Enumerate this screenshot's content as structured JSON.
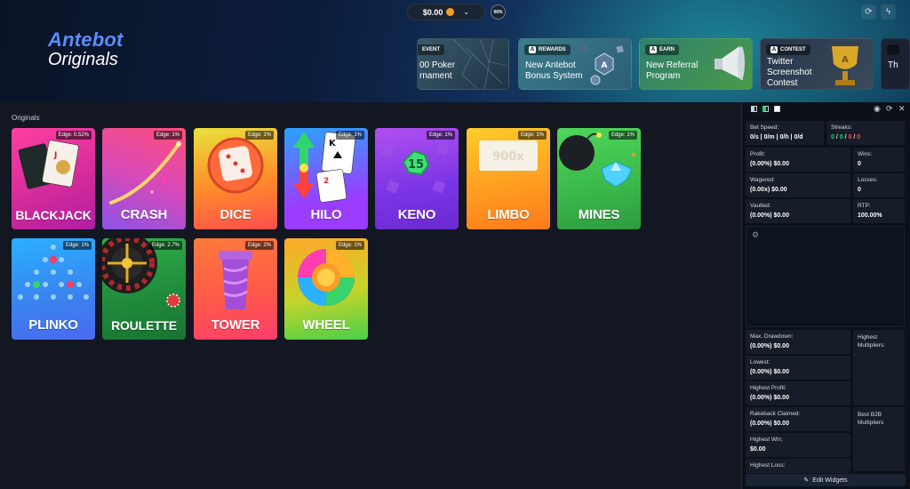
{
  "header": {
    "brand": "Antebot",
    "subtitle": "Originals",
    "balance": "$0.00",
    "percent": "06%"
  },
  "promos": [
    {
      "tag": "EVENT",
      "title": "00 Poker\nrnament"
    },
    {
      "tag": "REWARDS",
      "title": "New Antebot\nBonus System"
    },
    {
      "tag": "EARN",
      "title": "New Referral\nProgram"
    },
    {
      "tag": "CONTEST",
      "title": "Twitter\nScreenshot\nContest"
    },
    {
      "tag": "",
      "title": "Th"
    }
  ],
  "section_label": "Originals",
  "games": [
    {
      "name": "BLACKJACK",
      "edge": "Edge: 0.52%"
    },
    {
      "name": "CRASH",
      "edge": "Edge: 1%"
    },
    {
      "name": "DICE",
      "edge": "Edge: 1%"
    },
    {
      "name": "HILO",
      "edge": "Edge: 1%"
    },
    {
      "name": "KENO",
      "edge": "Edge: 1%"
    },
    {
      "name": "LIMBO",
      "edge": "Edge: 1%"
    },
    {
      "name": "MINES",
      "edge": "Edge: 1%"
    },
    {
      "name": "PLINKO",
      "edge": "Edge: 1%"
    },
    {
      "name": "ROULETTE",
      "edge": "Edge: 2.7%"
    },
    {
      "name": "TOWER",
      "edge": "Edge: 2%"
    },
    {
      "name": "WHEEL",
      "edge": "Edge: 1%"
    }
  ],
  "game_art": {
    "keno_number": "15",
    "limbo_multiplier": "900x",
    "hilo_card_top": "K",
    "hilo_card_bottom": "2"
  },
  "stats": {
    "bet_speed_label": "Bet Speed:",
    "bet_speed_value": "0/s | 0/m | 0/h | 0/d",
    "streaks_label": "Streaks:",
    "streak_1": "0",
    "streak_2": "0",
    "streak_3": "0",
    "streak_4": "0",
    "profit_label": "Profit:",
    "profit_value": "(0.00%) $0.00",
    "wins_label": "Wins:",
    "wins_value": "0",
    "wagered_label": "Wagered:",
    "wagered_value": "(0.00x) $0.00",
    "losses_label": "Losses:",
    "losses_value": "0",
    "vaulted_label": "Vaulted:",
    "vaulted_value": "(0.00%) $0.00",
    "rtp_label": "RTP:",
    "rtp_value": "100.00%",
    "max_drawdown_label": "Max. Drawdown:",
    "max_drawdown_value": "(0.00%) $0.00",
    "highest_multipliers_label": "Highest\nMultipliers:",
    "lowest_label": "Lowest:",
    "lowest_value": "(0.00%) $0.00",
    "highest_profit_label": "Highest Profit:",
    "highest_profit_value": "(0.00%) $0.00",
    "rakeback_label": "Rakeback Claimed:",
    "rakeback_value": "(0.00%) $0.00",
    "best_b2b_label": "Best B2B\nMultipliers",
    "highest_win_label": "Highest Win:",
    "highest_win_value": "$0.00",
    "highest_loss_label": "Highest Loss:"
  },
  "edit_widgets_label": "Edit Widgets",
  "colors": {
    "win": "#24d07a",
    "loss": "#ff4b4b",
    "accent": "#5a8cff"
  }
}
